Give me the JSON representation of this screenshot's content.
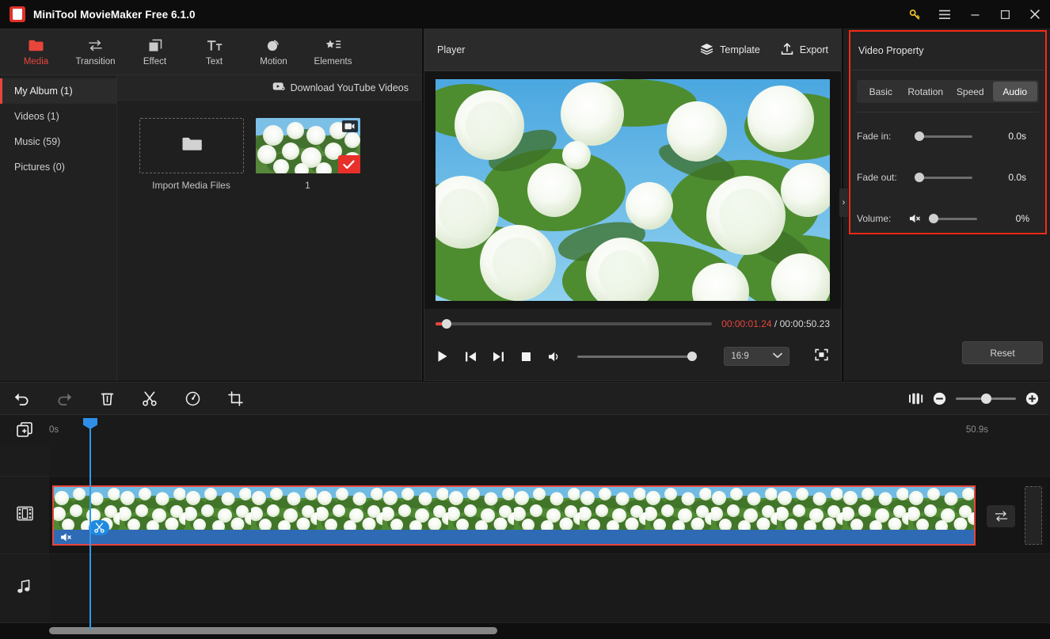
{
  "window": {
    "title": "MiniTool MovieMaker Free 6.1.0",
    "logo_icon": "app-logo-icon",
    "controls": [
      {
        "name": "license-key-button",
        "icon": "key-icon",
        "glyph": "⚷"
      },
      {
        "name": "menu-button",
        "icon": "hamburger-menu-icon"
      },
      {
        "name": "minimize-button",
        "icon": "minimize-icon"
      },
      {
        "name": "maximize-button",
        "icon": "maximize-icon"
      },
      {
        "name": "close-button",
        "icon": "close-icon"
      }
    ]
  },
  "toolbar_tabs": [
    {
      "label": "Media",
      "icon": "folder-icon",
      "active": true
    },
    {
      "label": "Transition",
      "icon": "transition-arrows-icon",
      "active": false
    },
    {
      "label": "Effect",
      "icon": "effect-squares-icon",
      "active": false
    },
    {
      "label": "Text",
      "icon": "text-tt-icon",
      "active": false
    },
    {
      "label": "Motion",
      "icon": "motion-circle-icon",
      "active": false
    },
    {
      "label": "Elements",
      "icon": "elements-star-list-icon",
      "active": false
    }
  ],
  "media": {
    "albums": [
      {
        "label": "My Album (1)",
        "active": true
      },
      {
        "label": "Videos (1)",
        "active": false
      },
      {
        "label": "Music (59)",
        "active": false
      },
      {
        "label": "Pictures (0)",
        "active": false
      }
    ],
    "download_label": "Download YouTube Videos",
    "download_icon": "youtube-download-icon",
    "import_label": "Import Media Files",
    "import_icon": "folder-open-icon",
    "items": [
      {
        "label": "1",
        "selected": true,
        "badge_icon": "video-camera-icon",
        "check_icon": "check-icon"
      }
    ]
  },
  "player": {
    "title": "Player",
    "template_label": "Template",
    "template_icon": "layers-icon",
    "export_label": "Export",
    "export_icon": "upload-icon",
    "current_time": "00:00:01.24",
    "separator": "/",
    "total_time": "00:00:50.23",
    "progress_percent": 2,
    "volume_percent": 100,
    "aspect_ratio": "16:9",
    "aspect_icon": "chevron-down-icon",
    "fullscreen_icon": "fullscreen-icon",
    "controls": [
      {
        "name": "play-button",
        "icon": "play-icon"
      },
      {
        "name": "previous-frame-button",
        "icon": "skip-back-icon"
      },
      {
        "name": "next-frame-button",
        "icon": "skip-forward-icon"
      },
      {
        "name": "stop-button",
        "icon": "stop-icon"
      },
      {
        "name": "volume-button",
        "icon": "speaker-icon"
      }
    ]
  },
  "video_property": {
    "title": "Video Property",
    "tabs": [
      {
        "label": "Basic",
        "active": false
      },
      {
        "label": "Rotation",
        "active": false
      },
      {
        "label": "Speed",
        "active": false
      },
      {
        "label": "Audio",
        "active": true
      }
    ],
    "rows": [
      {
        "label": "Fade in:",
        "value": "0.0s",
        "knob_percent": 0,
        "mute_icon": null
      },
      {
        "label": "Fade out:",
        "value": "0.0s",
        "knob_percent": 0,
        "mute_icon": null
      },
      {
        "label": "Volume:",
        "value": "0%",
        "knob_percent": 0,
        "mute_icon": "speaker-muted-icon"
      }
    ],
    "reset_label": "Reset",
    "highlight_color": "#f42a18"
  },
  "collapse_handle": {
    "glyph": "›",
    "name": "panel-collapse-handle"
  },
  "timeline_toolbar": {
    "buttons": [
      {
        "name": "undo-button",
        "icon": "undo-arrow-icon",
        "enabled": true
      },
      {
        "name": "redo-button",
        "icon": "redo-arrow-icon",
        "enabled": false
      },
      {
        "name": "delete-button",
        "icon": "trash-icon",
        "enabled": true
      },
      {
        "name": "split-button",
        "icon": "scissors-icon",
        "enabled": true
      },
      {
        "name": "speed-button",
        "icon": "speedometer-icon",
        "enabled": true
      },
      {
        "name": "crop-button",
        "icon": "crop-icon",
        "enabled": true
      }
    ],
    "split-view_icon": "split-view-icon",
    "zoom_out_icon": "zoom-minus-icon",
    "zoom_in_icon": "zoom-plus-icon",
    "zoom_percent": 42
  },
  "timeline": {
    "add_track_icon": "add-media-track-icon",
    "start_label": "0s",
    "end_label": "50.9s",
    "tracks": [
      {
        "name": "text-track",
        "icon": null
      },
      {
        "name": "video-track",
        "icon": "film-strip-icon"
      },
      {
        "name": "audio-track",
        "icon": "music-note-icon"
      }
    ],
    "clip": {
      "selected": true,
      "mute_icon": "speaker-muted-icon",
      "split_badge_icon": "scissors-icon",
      "border_color": "#e8453c"
    },
    "transition_button_icon": "transition-arrows-icon",
    "playhead_position_label": "0s"
  }
}
